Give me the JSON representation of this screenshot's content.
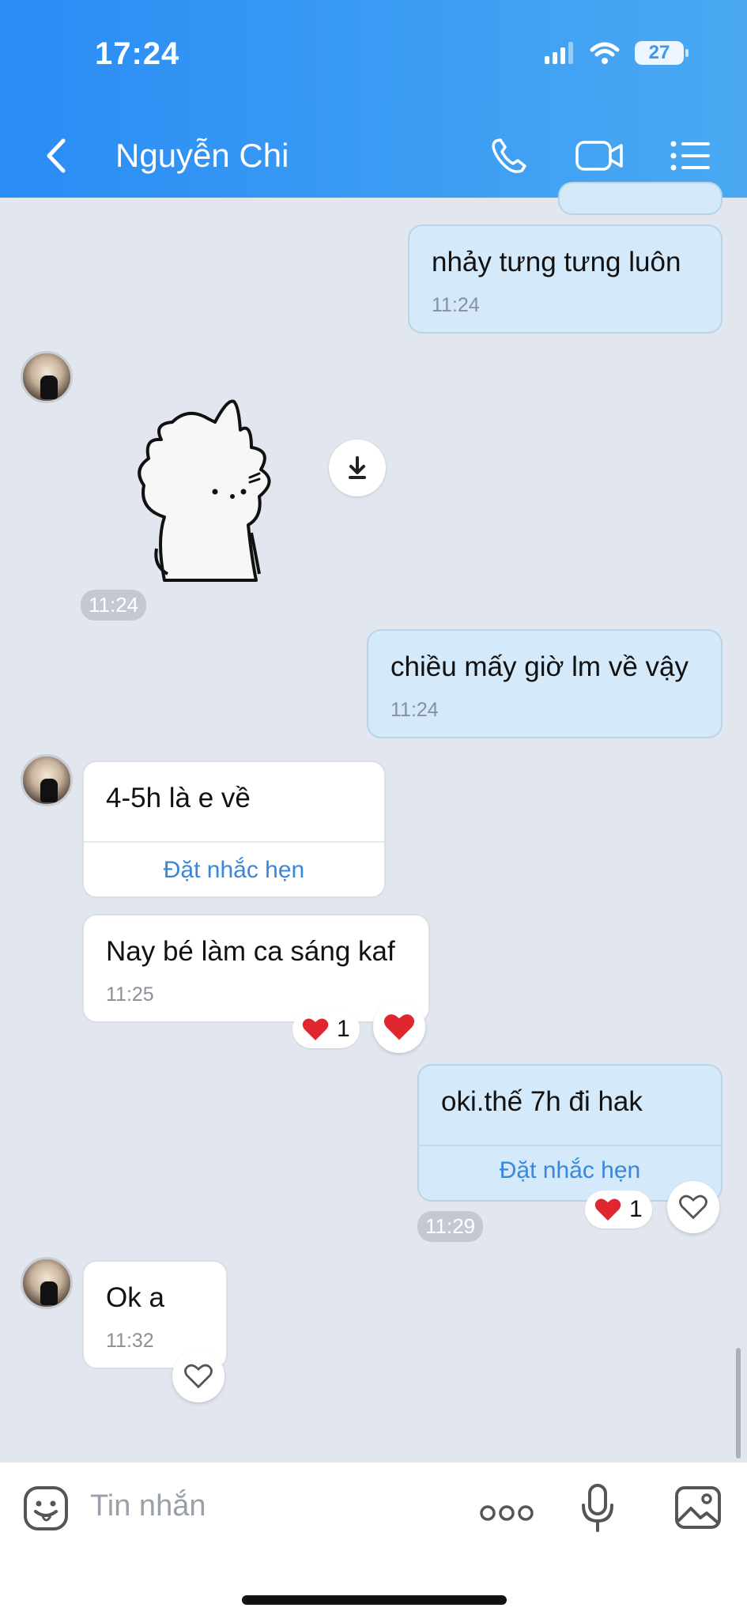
{
  "status_bar": {
    "time": "17:24",
    "battery": "27"
  },
  "header": {
    "contact_name": "Nguyễn Chi"
  },
  "messages": [
    {
      "text": "nhảy tưng tưng luôn",
      "time": "11:24"
    },
    {
      "sticker": "cat-sticker",
      "time": "11:24"
    },
    {
      "text": "chiều mấy giờ lm về vậy",
      "time": "11:24"
    },
    {
      "text": "4-5h là e về",
      "action": "Đặt nhắc hẹn"
    },
    {
      "text": "Nay bé làm ca sáng kaf",
      "time": "11:25",
      "reaction_count": "1"
    },
    {
      "text": "oki.thế 7h đi hak",
      "action": "Đặt nhắc hẹn",
      "time": "11:29",
      "reaction_count": "1"
    },
    {
      "text": "Ok a",
      "time": "11:32"
    }
  ],
  "composer": {
    "placeholder": "Tin nhắn"
  },
  "colors": {
    "header_start": "#2a8cf5",
    "header_end": "#4aa9f2",
    "my_bubble": "#d4e9fa",
    "chat_bg": "#e2e6ef",
    "link": "#3a86d9",
    "heart": "#e0262f"
  }
}
